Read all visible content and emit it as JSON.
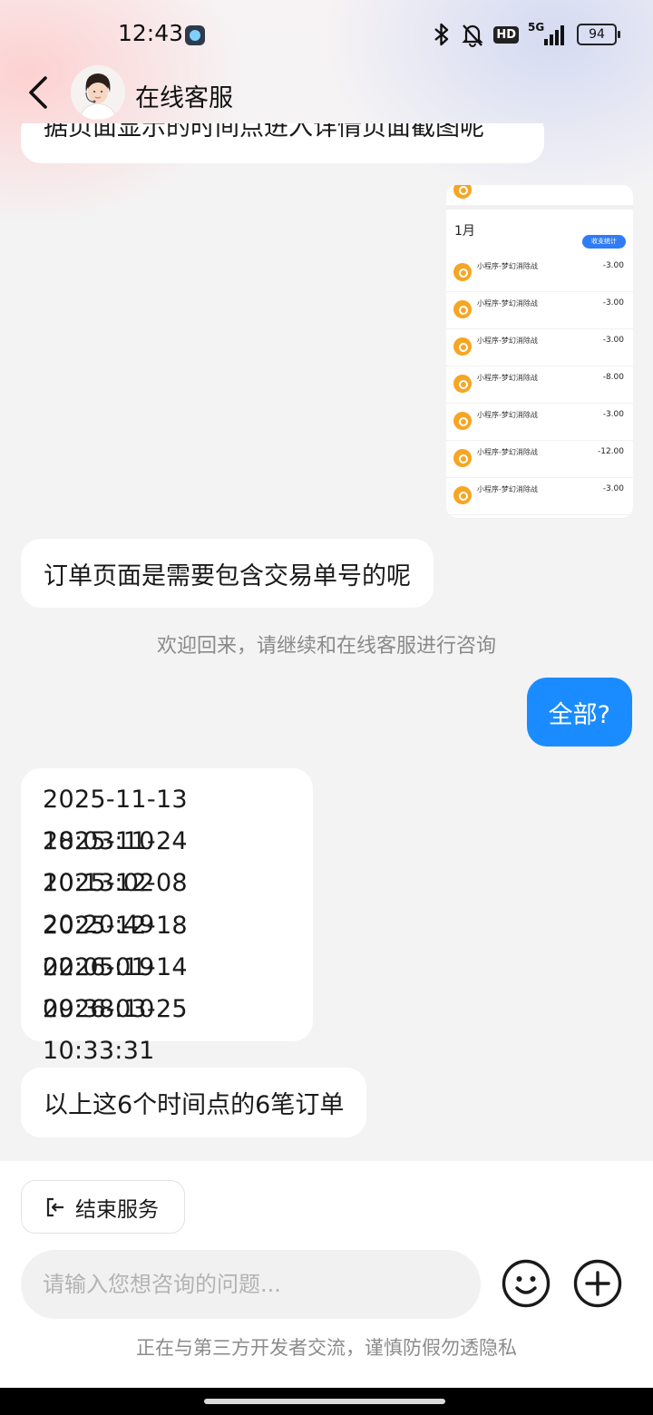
{
  "status_bar": {
    "time": "12:43",
    "signal": "5G",
    "hd": "HD",
    "battery": "94"
  },
  "header": {
    "title": "在线客服"
  },
  "messages": {
    "cut_text": "据页面显示的时间点进入详情页面截图呢",
    "order_reply": "订单页面是需要包含交易单号的呢",
    "system_note": "欢迎回来，请继续和在线客服进行咨询",
    "user_question": "全部?",
    "times": [
      "2025-11-13 18:03:10",
      "2025-11-24 10:13:02",
      "2025-12-08 20:20:49",
      "2025-12-18 02:05:19",
      "2026-01-14 09:38:10",
      "2026-03-25 10:33:31"
    ],
    "summary": "以上这6个时间点的6笔订单"
  },
  "screenshot": {
    "month": "1月",
    "button": "收支统计",
    "rows": [
      {
        "name": "小程序-梦幻消除战",
        "amount": "-3.00"
      },
      {
        "name": "小程序-梦幻消除战",
        "amount": "-3.00"
      },
      {
        "name": "小程序-梦幻消除战",
        "amount": "-3.00"
      },
      {
        "name": "小程序-梦幻消除战",
        "amount": "-8.00"
      },
      {
        "name": "小程序-梦幻消除战",
        "amount": "-3.00"
      },
      {
        "name": "小程序-梦幻消除战",
        "amount": "-12.00"
      },
      {
        "name": "小程序-梦幻消除战",
        "amount": "-3.00"
      }
    ]
  },
  "bottom": {
    "end_service": "结束服务",
    "input_placeholder": "请输入您想咨询的问题...",
    "disclaimer": "正在与第三方开发者交流，谨慎防假勿透隐私"
  },
  "colors": {
    "accent": "#1a8cff",
    "coin": "#f6a623"
  },
  "icons": [
    "back-arrow-icon",
    "emoji-icon",
    "plus-icon",
    "exit-icon",
    "bluetooth-icon",
    "mute-icon"
  ]
}
